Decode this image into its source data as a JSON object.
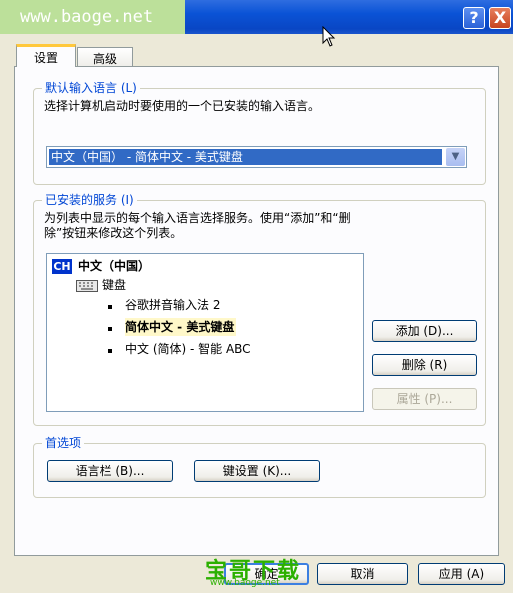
{
  "window": {
    "watermark": "www.baoge.net",
    "help": "?",
    "close": "X"
  },
  "tabs": [
    {
      "label": "设置"
    },
    {
      "label": "高级"
    }
  ],
  "default_language": {
    "title": "默认输入语言 (L)",
    "description": "选择计算机启动时要使用的一个已安装的输入语言。",
    "selected": "中文（中国） - 简体中文 - 美式键盘"
  },
  "installed_services": {
    "title": "已安装的服务 (I)",
    "description_line1": "为列表中显示的每个输入语言选择服务。使用“添加”和“删",
    "description_line2": "除”按钮来修改这个列表。",
    "tree": {
      "language_code": "CH",
      "language": "中文（中国）",
      "category": "键盘",
      "items": [
        {
          "label": "谷歌拼音输入法 2"
        },
        {
          "label": "简体中文 - 美式键盘"
        },
        {
          "label": "中文 (简体) - 智能 ABC"
        }
      ]
    },
    "buttons": {
      "add": "添加 (D)...",
      "remove": "删除 (R)",
      "properties": "属性 (P)..."
    }
  },
  "preferences": {
    "title": "首选项",
    "language_bar": "语言栏 (B)...",
    "key_settings": "键设置 (K)..."
  },
  "footer": {
    "ok": "确定",
    "cancel": "取消",
    "apply": "应用 (A)"
  },
  "overlay": {
    "logo": "宝哥下载",
    "url": "www.baoge.net"
  }
}
